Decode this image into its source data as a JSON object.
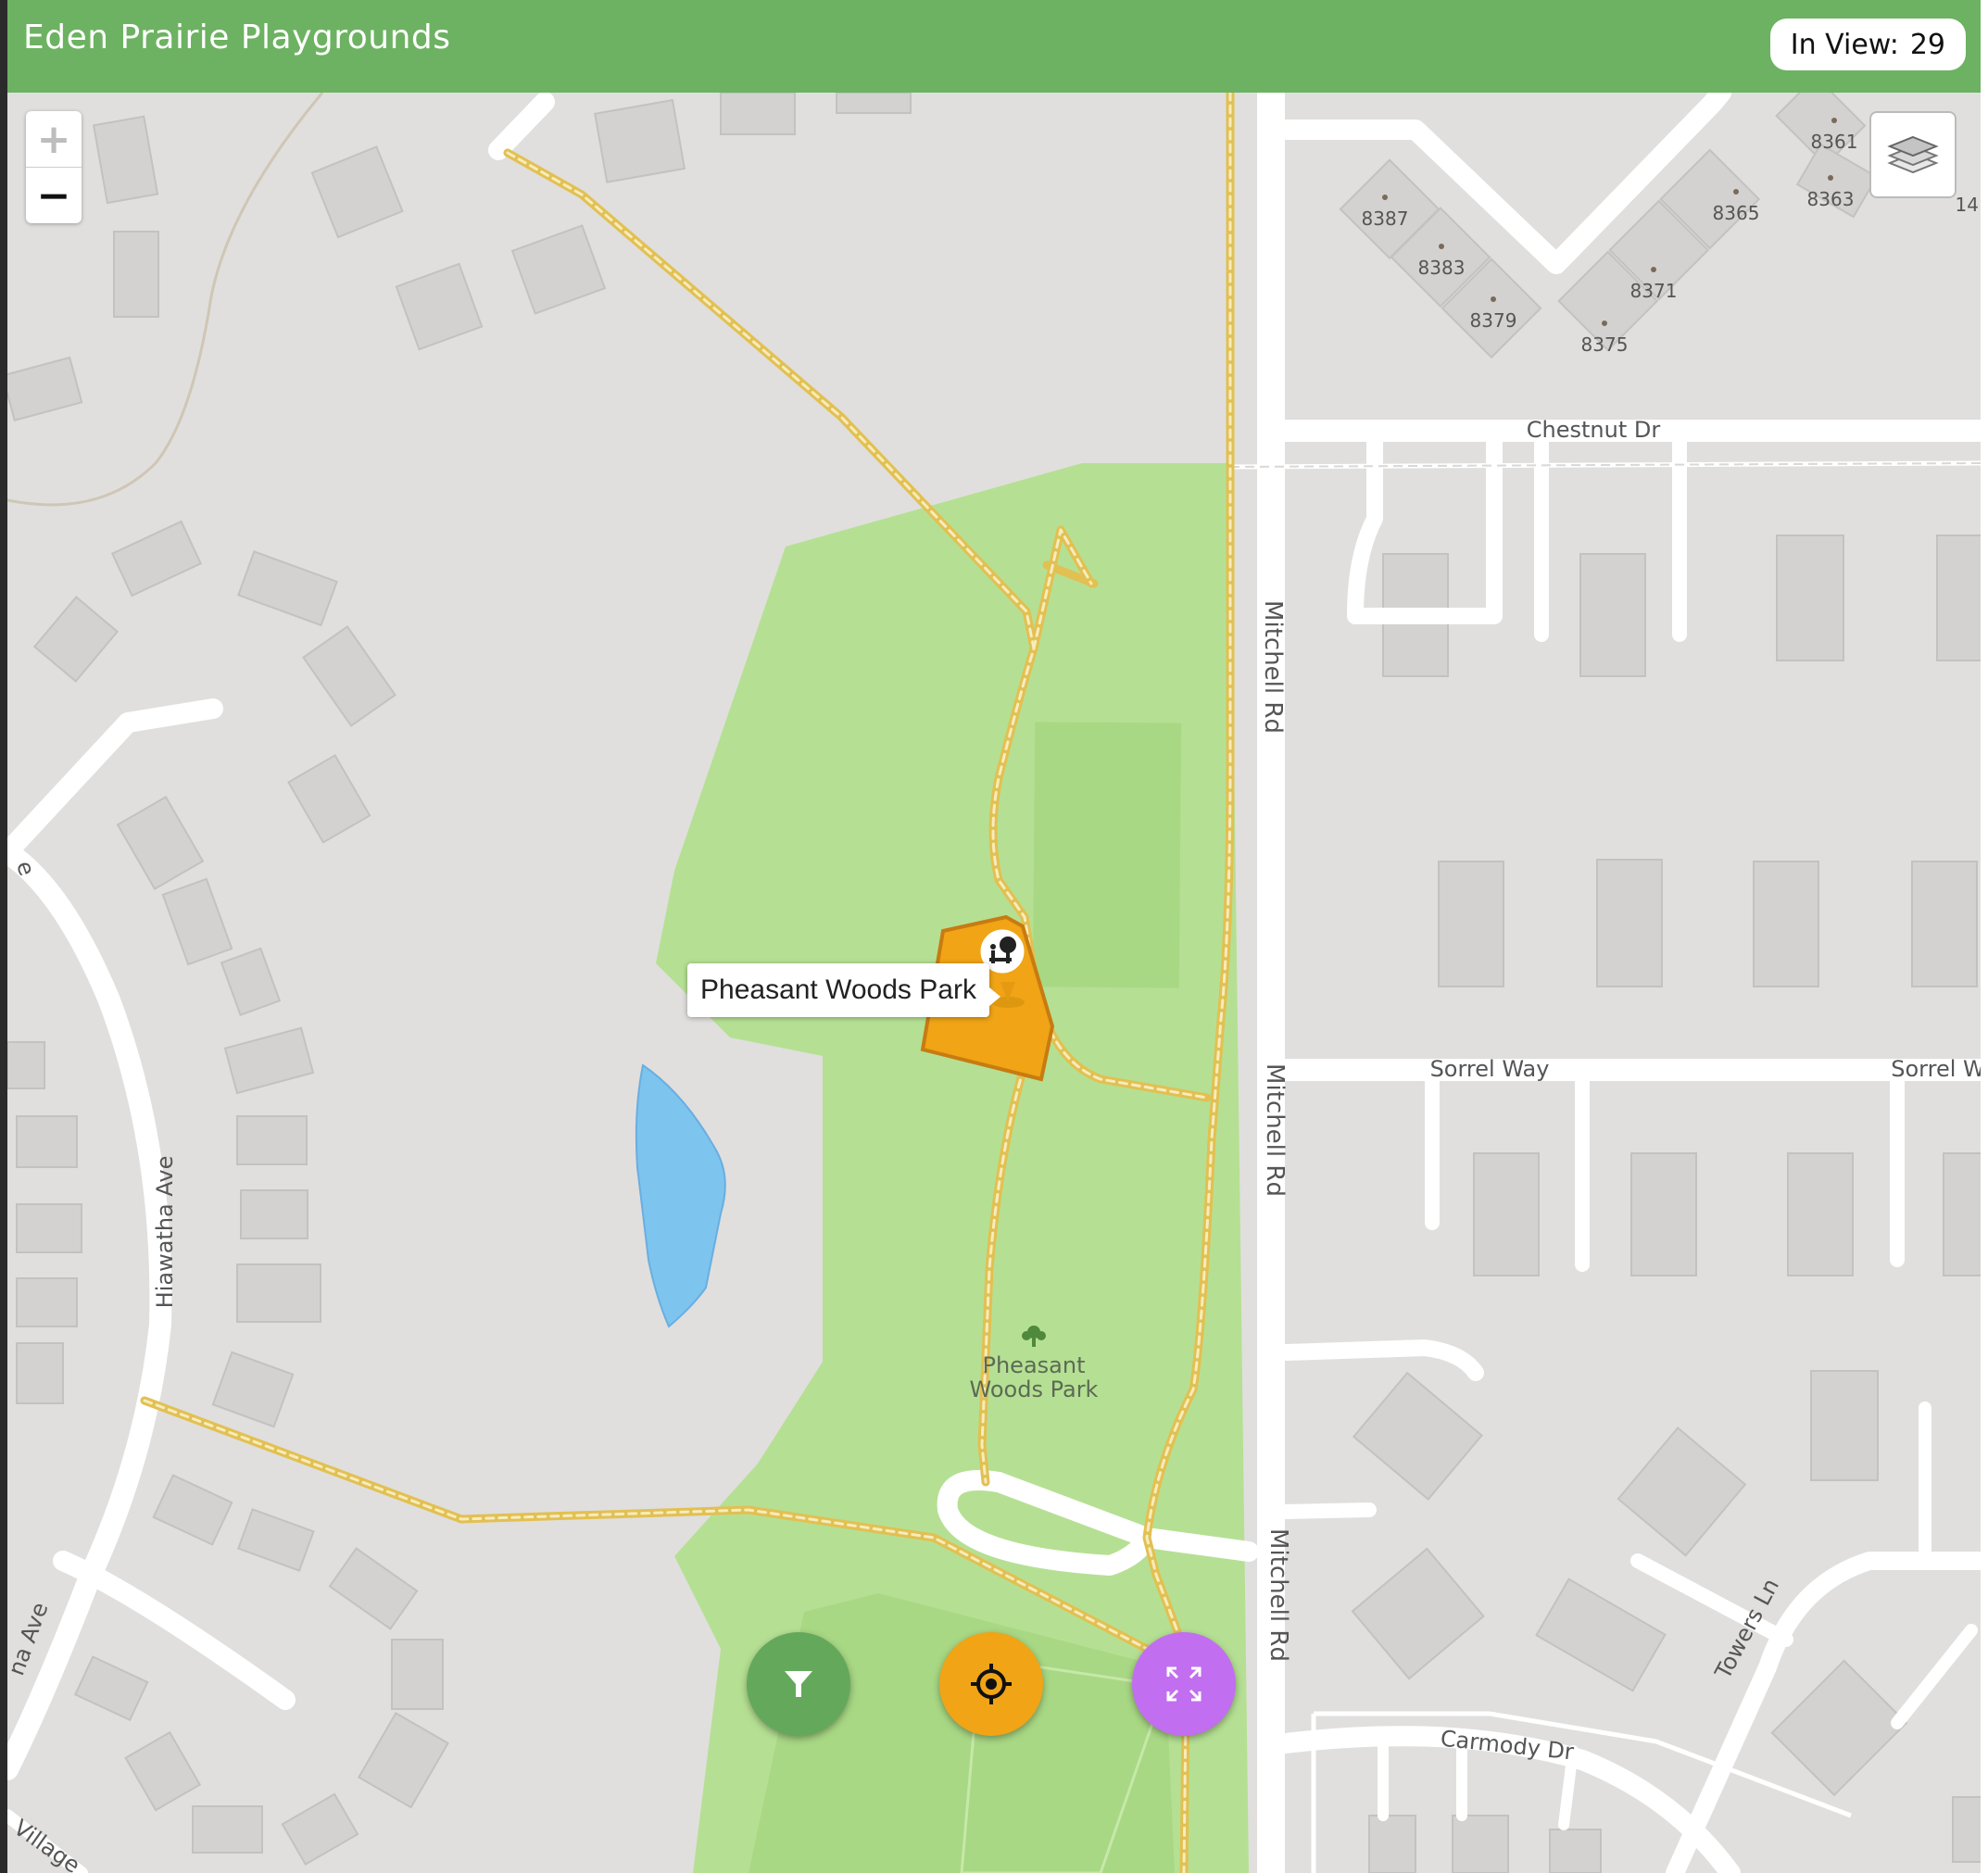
{
  "header": {
    "title": "Eden Prairie Playgrounds",
    "in_view_label": "In View:",
    "in_view_count": "29"
  },
  "map": {
    "zoom_in": "+",
    "zoom_out": "−",
    "tooltip": "Pheasant Woods Park",
    "park_label_line1": "Pheasant",
    "park_label_line2": "Woods Park",
    "streets": {
      "chestnut": "Chestnut Dr",
      "mitchell": "Mitchell Rd",
      "sorrel": "Sorrel Way",
      "sorrel_cut": "Sorrel W",
      "hiawatha": "Hiawatha Ave",
      "hiawatha_cut": "na Ave",
      "towers": "Towers Ln",
      "carmody": "Carmody Dr",
      "village": "Village",
      "ave_cut": "e"
    },
    "addresses": [
      "8361",
      "8387",
      "8365",
      "8363",
      "8383",
      "8371",
      "8379",
      "8375",
      "14"
    ]
  },
  "buttons": {
    "filter": "filter-icon",
    "locate": "crosshair-icon",
    "fullscreen": "expand-icon",
    "layers": "layers-icon"
  },
  "colors": {
    "header": "#6db262",
    "park": "#b5e093",
    "playground": "#f0a416",
    "water": "#7dc4ef",
    "trail": "#e8c85a"
  }
}
